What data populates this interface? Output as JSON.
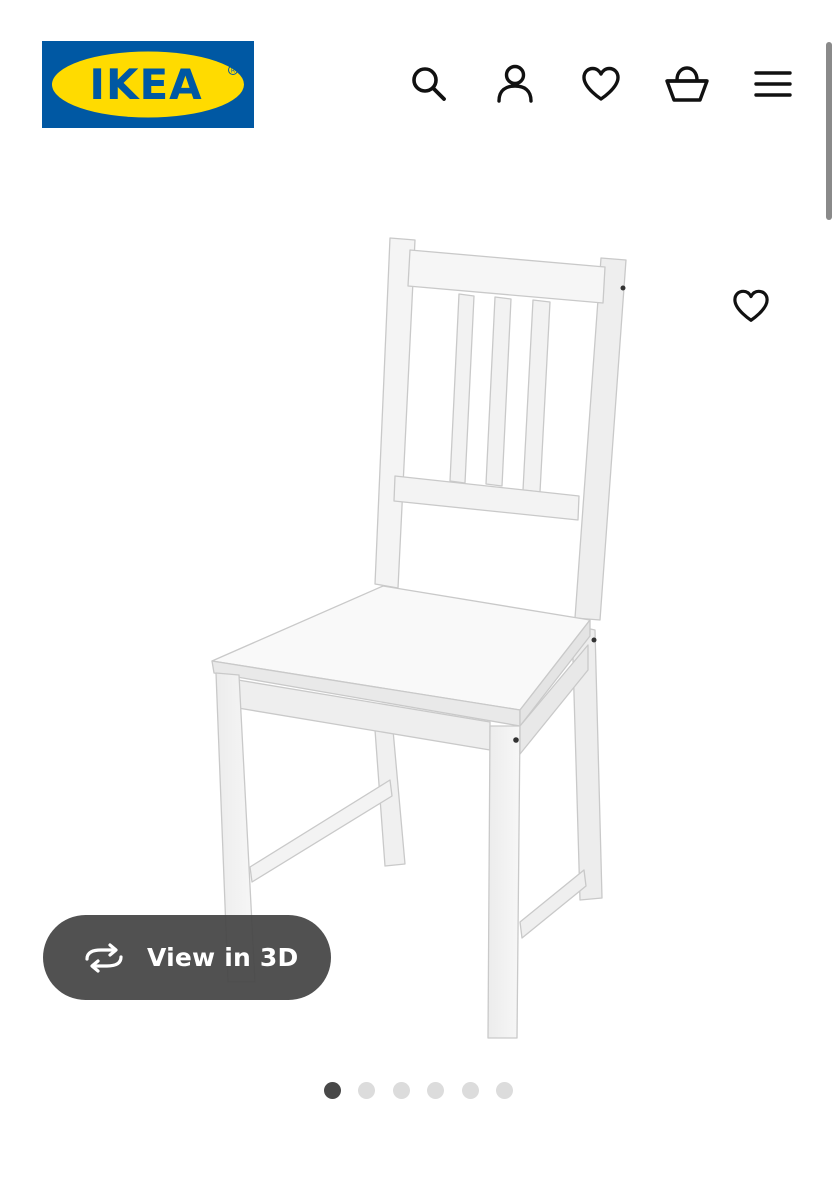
{
  "header": {
    "logo_text": "IKEA",
    "icons": {
      "search": "search-icon",
      "account": "user-icon",
      "favourites": "heart-icon",
      "basket": "basket-icon",
      "menu": "menu-icon"
    }
  },
  "gallery": {
    "image": "white wooden chair",
    "favourite_icon": "heart-icon",
    "view_3d": {
      "label": "View in 3D",
      "icon": "rotate-3d-icon"
    },
    "pagination": {
      "total": 6,
      "active_index": 1
    }
  },
  "colors": {
    "ikea_blue": "#0058A3",
    "ikea_yellow": "#FFDB00",
    "button_bg": "#484848",
    "dot_active": "#484848",
    "dot_inactive": "#DCDCDC"
  }
}
